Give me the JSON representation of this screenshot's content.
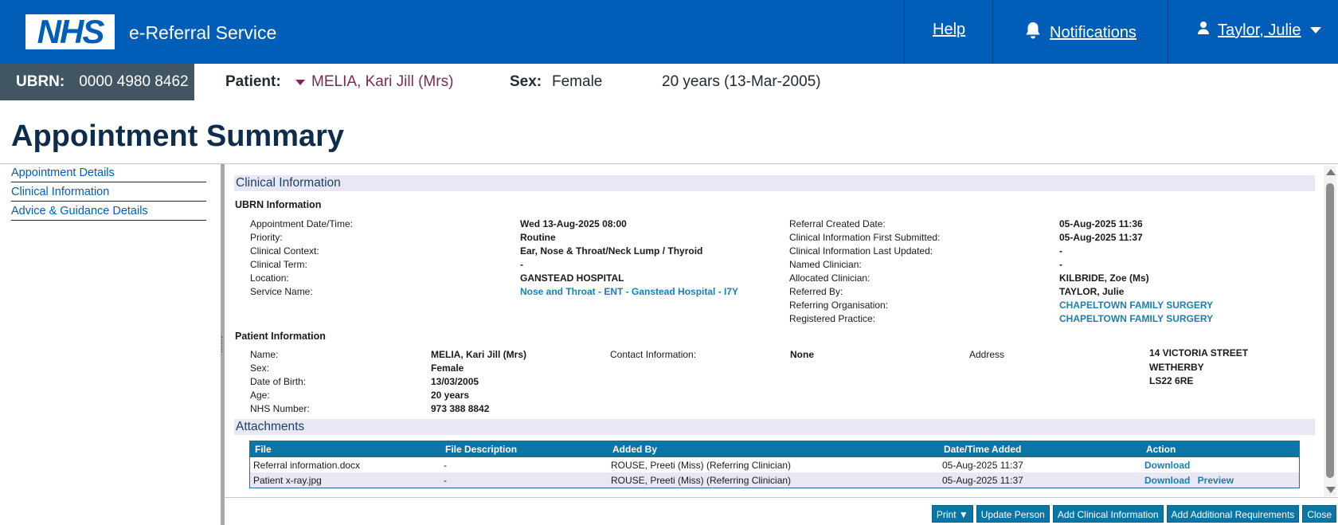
{
  "header": {
    "logo": "NHS",
    "service_name": "e-Referral Service",
    "help": "Help",
    "notifications": "Notifications",
    "user": "Taylor, Julie",
    "icons": {
      "notifications": "bell-icon",
      "user": "person-icon",
      "menu": "chevron-down-icon"
    }
  },
  "banner": {
    "ubrn_label": "UBRN:",
    "ubrn_value": "0000 4980 8462",
    "patient_label": "Patient:",
    "patient_name": "MELIA, Kari Jill (Mrs)",
    "sex_label": "Sex:",
    "sex_value": "Female",
    "age_dob": "20 years (13-Mar-2005)"
  },
  "page_title": "Appointment Summary",
  "nav": [
    "Appointment Details",
    "Clinical Information",
    "Advice & Guidance Details"
  ],
  "clinical": {
    "title": "Clinical Information",
    "ubrn_heading": "UBRN Information",
    "left": [
      {
        "label": "Appointment Date/Time:",
        "value": "Wed 13-Aug-2025 08:00"
      },
      {
        "label": "Priority:",
        "value": "Routine"
      },
      {
        "label": "Clinical Context:",
        "value": "Ear, Nose & Throat/Neck Lump / Thyroid"
      },
      {
        "label": "Clinical Term:",
        "value": "-"
      },
      {
        "label": "Location:",
        "value": "GANSTEAD HOSPITAL"
      },
      {
        "label": "Service Name:",
        "value": "Nose and Throat - ENT - Ganstead Hospital - I7Y"
      }
    ],
    "right": [
      {
        "label": "Referral Created Date:",
        "value": "05-Aug-2025 11:36"
      },
      {
        "label": "Clinical Information First Submitted:",
        "value": "05-Aug-2025 11:37"
      },
      {
        "label": "Clinical Information Last Updated:",
        "value": "-"
      },
      {
        "label": "Named Clinician:",
        "value": "-"
      },
      {
        "label": "Allocated Clinician:",
        "value": "KILBRIDE, Zoe (Ms)"
      },
      {
        "label": "Referred By:",
        "value": "TAYLOR, Julie"
      },
      {
        "label": "Referring Organisation:",
        "value": "CHAPELTOWN FAMILY SURGERY"
      },
      {
        "label": "Registered Practice:",
        "value": "CHAPELTOWN FAMILY SURGERY"
      }
    ]
  },
  "patient_info": {
    "heading": "Patient Information",
    "rows": [
      {
        "label": "Name:",
        "value": "MELIA, Kari Jill (Mrs)"
      },
      {
        "label": "Sex:",
        "value": "Female"
      },
      {
        "label": "Date of Birth:",
        "value": "13/03/2005"
      },
      {
        "label": "Age:",
        "value": "20 years"
      },
      {
        "label": "NHS Number:",
        "value": "973 388 8842"
      }
    ],
    "contact_label": "Contact Information:",
    "contact_value": "None",
    "address_label": "Address",
    "address_lines": [
      "14 VICTORIA STREET",
      "WETHERBY",
      "LS22 6RE"
    ]
  },
  "attachments": {
    "title": "Attachments",
    "columns": [
      "File",
      "File Description",
      "Added By",
      "Date/Time Added",
      "Action"
    ],
    "rows": [
      {
        "file": "Referral information.docx",
        "description": "-",
        "added_by": "ROUSE, Preeti (Miss) (Referring Clinician)",
        "date": "05-Aug-2025 11:37",
        "actions": [
          "Download"
        ]
      },
      {
        "file": "Patient x-ray.jpg",
        "description": "-",
        "added_by": "ROUSE, Preeti (Miss) (Referring Clinician)",
        "date": "05-Aug-2025 11:37",
        "actions": [
          "Download",
          "Preview"
        ]
      }
    ]
  },
  "buttons": [
    "Print ▼",
    "Update Person",
    "Add Clinical Information",
    "Add Additional Requirements",
    "Close"
  ]
}
